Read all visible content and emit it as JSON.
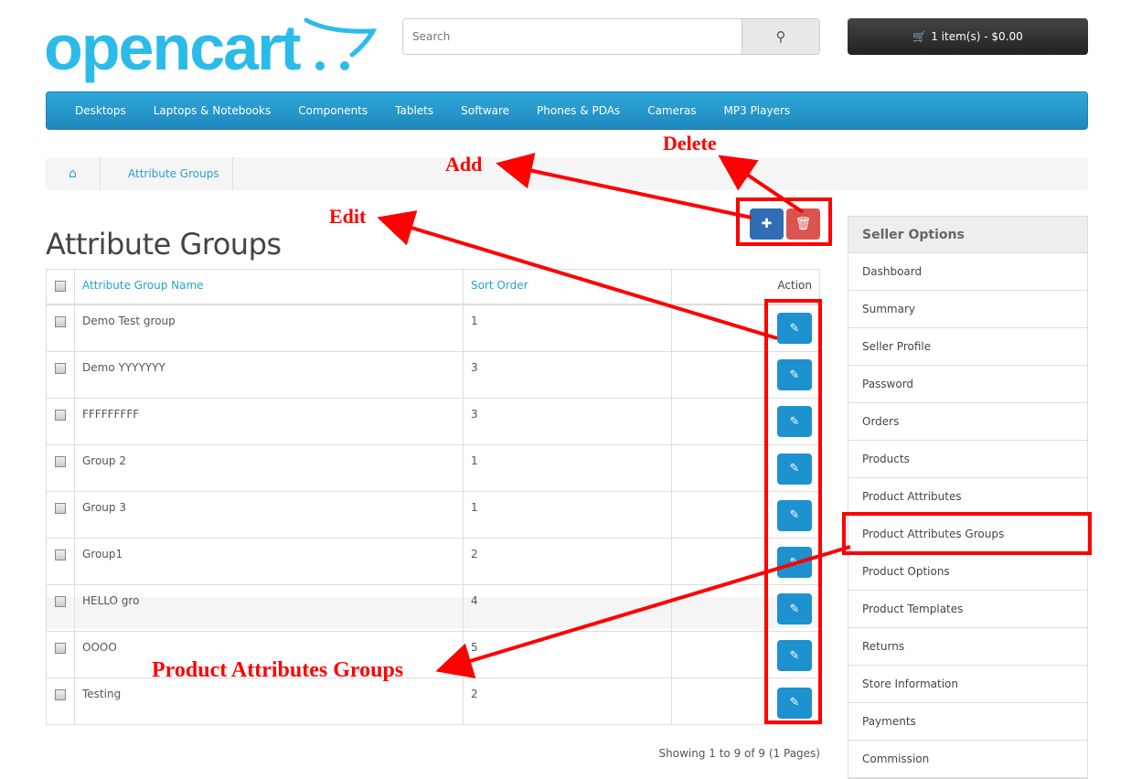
{
  "header": {
    "logo_text": "opencart",
    "search_placeholder": "Search",
    "search_icon": "magnifier-icon",
    "cart_label": "1 item(s) - $0.00",
    "cart_icon": "shopping-cart-icon"
  },
  "nav": {
    "items": [
      "Desktops",
      "Laptops & Notebooks",
      "Components",
      "Tablets",
      "Software",
      "Phones & PDAs",
      "Cameras",
      "MP3 Players"
    ]
  },
  "breadcrumb": {
    "home_icon": "home-icon",
    "items": [
      "Attribute Groups"
    ]
  },
  "page": {
    "title": "Attribute Groups"
  },
  "table": {
    "headers": {
      "name": "Attribute Group Name",
      "sort": "Sort Order",
      "action": "Action"
    },
    "rows": [
      {
        "name": "Demo Test group",
        "sort": "1"
      },
      {
        "name": "Demo YYYYYYY",
        "sort": "3"
      },
      {
        "name": "FFFFFFFFF",
        "sort": "3"
      },
      {
        "name": "Group 2",
        "sort": "1"
      },
      {
        "name": "Group 3",
        "sort": "1"
      },
      {
        "name": "Group1",
        "sort": "2"
      },
      {
        "name": "HELLO gro",
        "sort": "4"
      },
      {
        "name": "OOOO",
        "sort": "5"
      },
      {
        "name": "Testing",
        "sort": "2"
      }
    ],
    "pagination": "Showing 1 to 9 of 9 (1 Pages)"
  },
  "sidebar": {
    "title": "Seller Options",
    "items": [
      "Dashboard",
      "Summary",
      "Seller Profile",
      "Password",
      "Orders",
      "Products",
      "Product Attributes",
      "Product Attributes Groups",
      "Product Options",
      "Product Templates",
      "Returns",
      "Store Information",
      "Payments",
      "Commission"
    ]
  },
  "annotations": {
    "add": "Add",
    "delete": "Delete",
    "edit": "Edit",
    "groups": "Product Attributes Groups",
    "color": "#ff0000"
  }
}
